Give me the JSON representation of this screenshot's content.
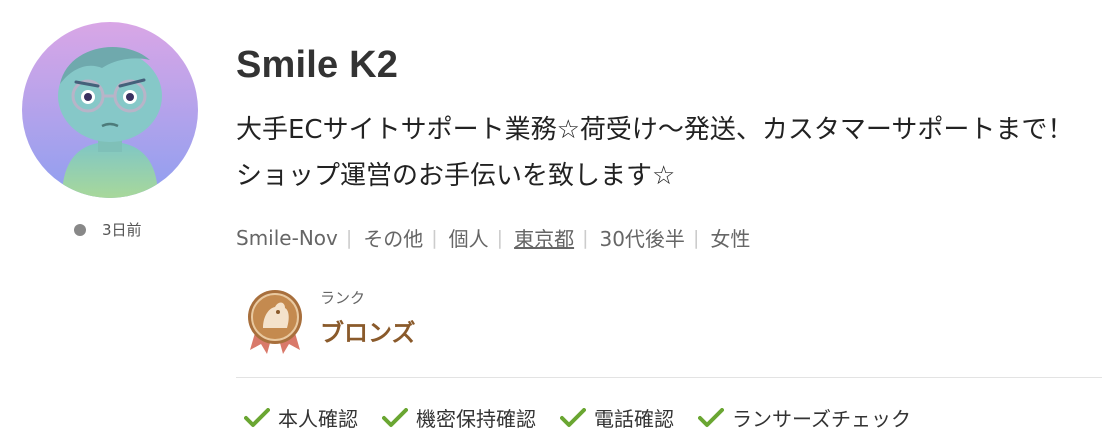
{
  "profile": {
    "name": "Smile K2",
    "tagline": "大手ECサイトサポート業務☆荷受け〜発送、カスタマーサポートまで！ショップ運営のお手伝いを致します☆",
    "last_seen": "3日前",
    "status_color": "#888888"
  },
  "meta": {
    "username": "Smile-Nov",
    "category": "その他",
    "type": "個人",
    "location": "東京都",
    "age": "30代後半",
    "gender": "女性"
  },
  "rank": {
    "label": "ランク",
    "value": "ブロンズ",
    "badge_color": "#a86f3c",
    "ribbon_color": "#d9796a"
  },
  "verifications": [
    {
      "label": "本人確認"
    },
    {
      "label": "機密保持確認"
    },
    {
      "label": "電話確認"
    },
    {
      "label": "ランサーズチェック"
    }
  ],
  "colors": {
    "check": "#6aa632",
    "rank_text": "#8a5a2b"
  }
}
